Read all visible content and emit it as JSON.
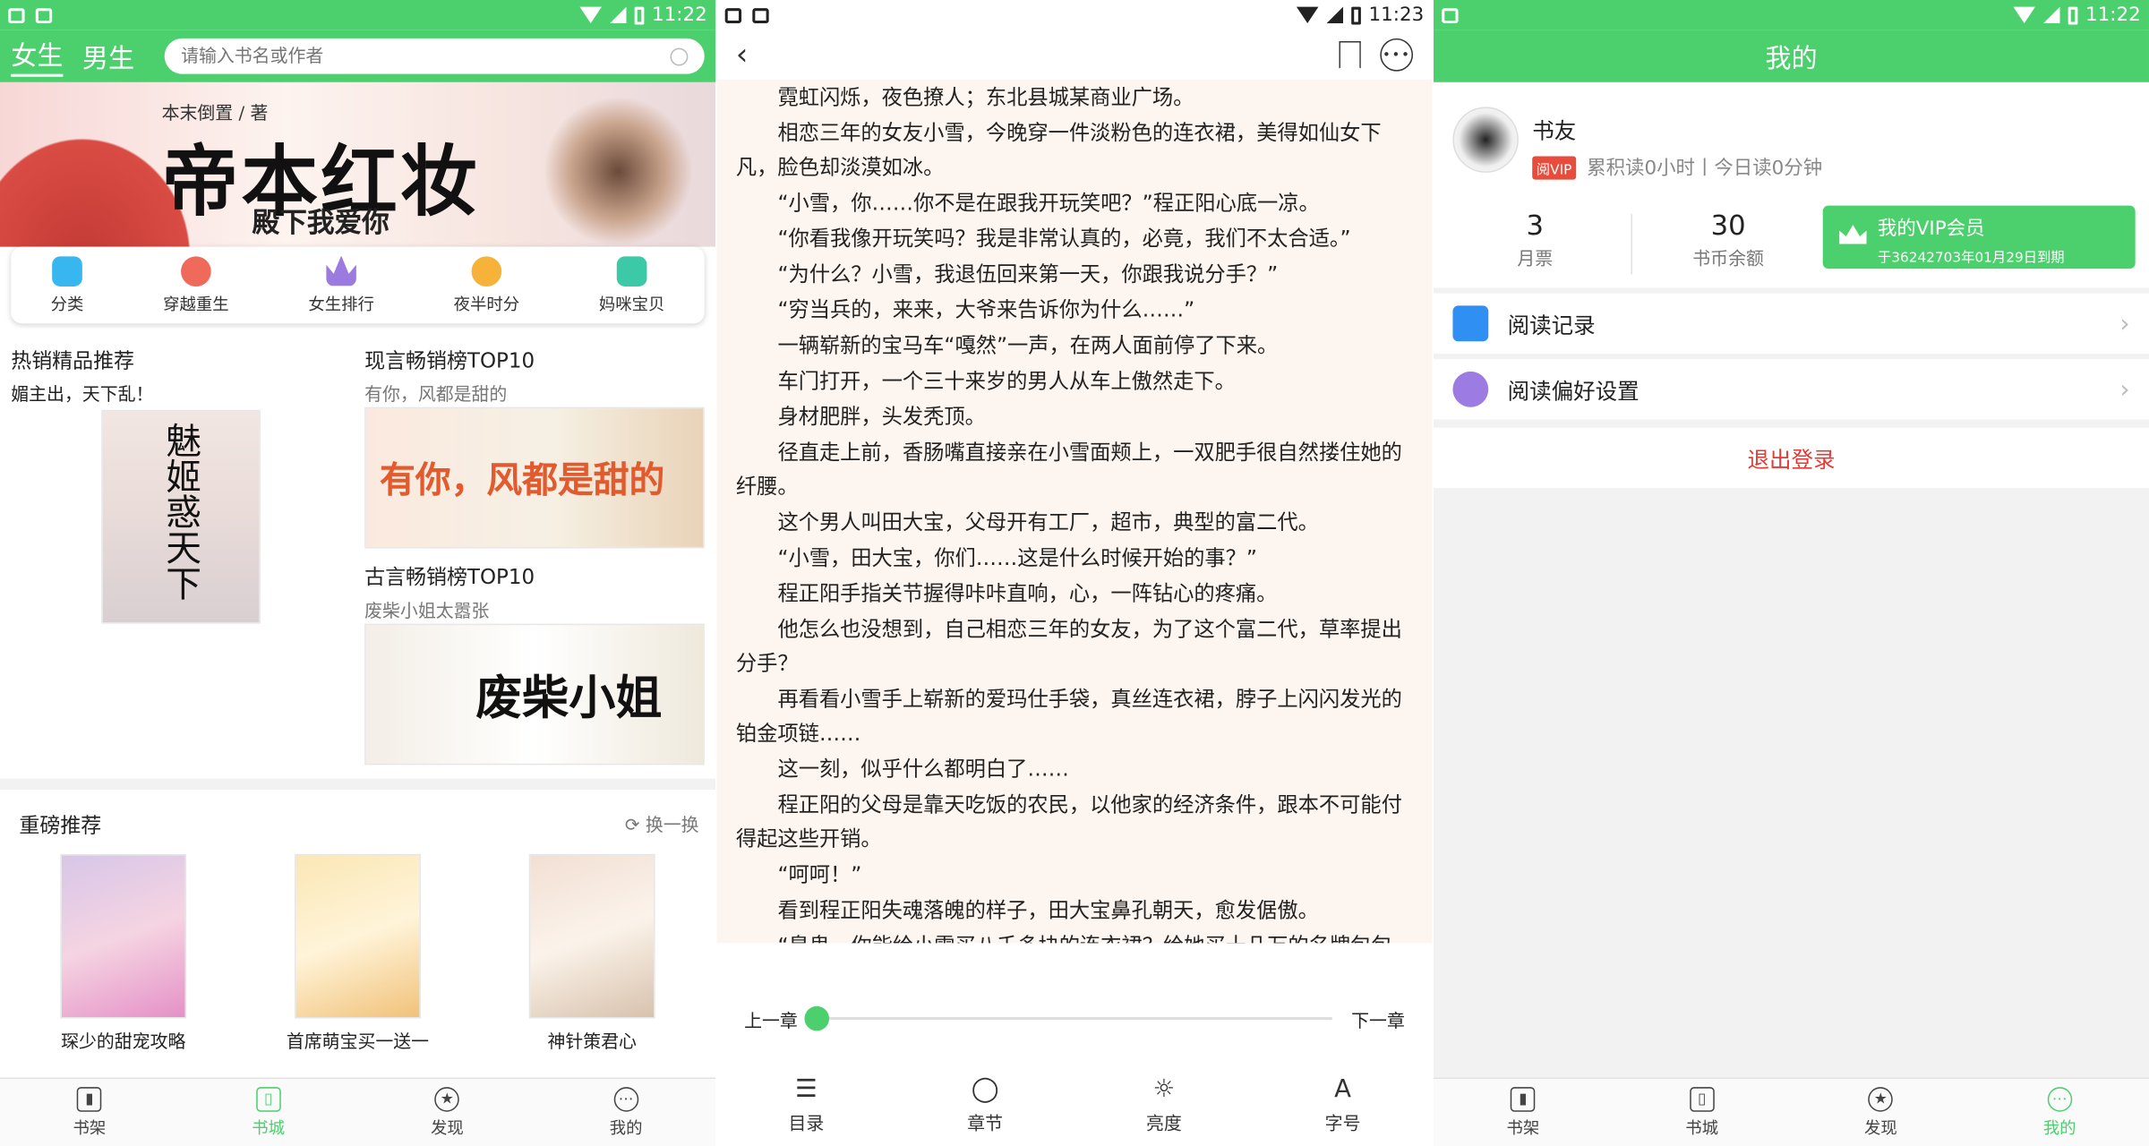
{
  "status": {
    "time_1": "11:22",
    "time_2": "11:23",
    "time_3": "11:22"
  },
  "store": {
    "tabs": [
      "女生",
      "男生"
    ],
    "search_placeholder": "请输入书名或作者",
    "banner": {
      "author": "本末倒置 / 著",
      "title": "帝本红妆",
      "subtitle": "殿下我爱你"
    },
    "categories": [
      {
        "label": "分类",
        "color": "#38b6f0"
      },
      {
        "label": "穿越重生",
        "color": "#f06a5b"
      },
      {
        "label": "女生排行",
        "color": "#9b7be0"
      },
      {
        "label": "夜半时分",
        "color": "#f7b23a"
      },
      {
        "label": "妈咪宝贝",
        "color": "#3cc9a8"
      }
    ],
    "recommend": {
      "left_title": "热销精品推荐",
      "left_desc": "媚主出，天下乱！",
      "left_cover": "魅姬惑天下",
      "top10_modern": "现言畅销榜TOP10",
      "modern_desc": "有你，风都是甜的",
      "modern_cover": "有你，风都是甜的",
      "top10_ancient": "古言畅销榜TOP10",
      "ancient_desc": "废柴小姐太嚣张",
      "ancient_cover": "废柴小姐"
    },
    "hot": {
      "title": "重磅推荐",
      "refresh": "换一换",
      "books": [
        "琛少的甜宠攻略",
        "首席萌宝买一送一",
        "神针策君心"
      ]
    }
  },
  "tabs_bottom": [
    "书架",
    "书城",
    "发现",
    "我的"
  ],
  "reader": {
    "paragraphs": [
      "霓虹闪烁，夜色撩人；东北县城某商业广场。",
      "相恋三年的女友小雪，今晚穿一件淡粉色的连衣裙，美得如仙女下凡，脸色却淡漠如冰。",
      "“小雪，你……你不是在跟我开玩笑吧？”程正阳心底一凉。",
      "“你看我像开玩笑吗？我是非常认真的，必竟，我们不太合适。”",
      "“为什么？小雪，我退伍回来第一天，你跟我说分手？”",
      "“穷当兵的，来来，大爷来告诉你为什么……”",
      "一辆崭新的宝马车“嘎然”一声，在两人面前停了下来。",
      "车门打开，一个三十来岁的男人从车上傲然走下。",
      "身材肥胖，头发秃顶。",
      "径直走上前，香肠嘴直接亲在小雪面颊上，一双肥手很自然搂住她的纤腰。",
      "这个男人叫田大宝，父母开有工厂，超市，典型的富二代。",
      "“小雪，田大宝，你们……这是什么时候开始的事？”",
      "程正阳手指关节握得咔咔直响，心，一阵钻心的疼痛。",
      "他怎么也没想到，自己相恋三年的女友，为了这个富二代，草率提出分手？",
      "再看看小雪手上崭新的爱玛仕手袋，真丝连衣裙，脖子上闪闪发光的铂金项链……",
      "这一刻，似乎什么都明白了……",
      "程正阳的父母是靠天吃饭的农民，以他家的经济条件，跟本不可能付得起这些开销。",
      "“呵呵！”",
      "看到程正阳失魂落魄的样子，田大宝鼻孔朝天，愈发倨傲。",
      "“臭鬼，你能给小雪买八千多块的连衣裙？给她买十几万的名牌包包"
    ],
    "prev": "上一章",
    "next": "下一章",
    "progress_fraction": 0.0,
    "tools": [
      {
        "label": "目录",
        "icon": "list-icon"
      },
      {
        "label": "章节",
        "icon": "chapter-slider-icon"
      },
      {
        "label": "亮度",
        "icon": "brightness-icon"
      },
      {
        "label": "字号",
        "icon": "font-size-icon"
      }
    ]
  },
  "profile": {
    "title": "我的",
    "name": "书友",
    "vip_tag": "阅VIP",
    "read_stats": "累积读0小时丨今日读0分钟",
    "monthly_ticket_value": "3",
    "monthly_ticket_label": "月票",
    "coin_value": "30",
    "coin_label": "书币余额",
    "vip_title": "我的VIP会员",
    "vip_expire": "于36242703年01月29日到期",
    "rows": [
      {
        "label": "阅读记录",
        "color": "#2f8ff2"
      },
      {
        "label": "阅读偏好设置",
        "color": "#9c7be3"
      }
    ],
    "logout": "退出登录"
  },
  "colors": {
    "accent": "#4cd06d",
    "danger": "#e53935",
    "reader_bg": "#fdf5ef"
  }
}
